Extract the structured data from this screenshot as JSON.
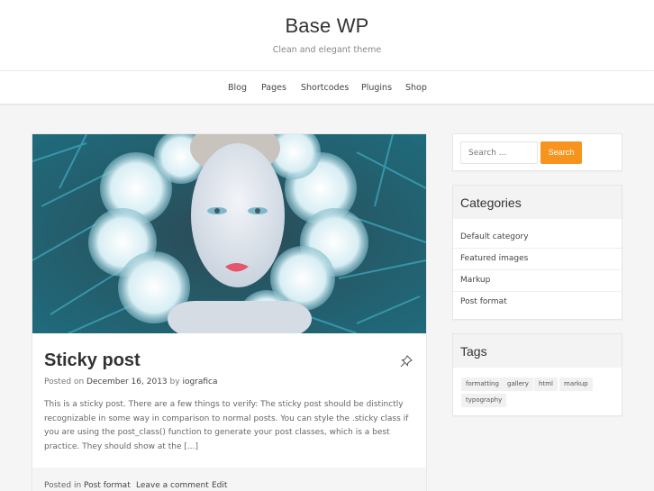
{
  "header": {
    "site_title": "Base WP",
    "site_description": "Clean and elegant theme"
  },
  "nav": {
    "items": [
      {
        "label": "Blog"
      },
      {
        "label": "Pages"
      },
      {
        "label": "Shortcodes"
      },
      {
        "label": "Plugins"
      },
      {
        "label": "Shop"
      }
    ]
  },
  "post": {
    "featured_image_alt": "Woman lying among white flowers and teal grass",
    "title": "Sticky post",
    "sticky_icon": "pushpin-icon",
    "meta": {
      "posted_on_label": "Posted on",
      "date": "December 16, 2013",
      "by_label": "by",
      "author": "iografica"
    },
    "excerpt": "This is a sticky post. There are a few things to verify: The sticky post should be distinctly recognizable in some way in comparison to normal posts. You can style the .sticky class if you are using the post_class() function to generate your post classes, which is a best practice. They should show at the [...]",
    "footer": {
      "posted_in_label": "Posted in",
      "category": "Post format",
      "comment_link": "Leave a comment",
      "edit_link": "Edit"
    }
  },
  "sidebar": {
    "search": {
      "placeholder": "Search ...",
      "button_label": "Search",
      "accent_color": "#f7941d"
    },
    "categories": {
      "title": "Categories",
      "items": [
        {
          "label": "Default category"
        },
        {
          "label": "Featured images"
        },
        {
          "label": "Markup"
        },
        {
          "label": "Post format"
        }
      ]
    },
    "tags": {
      "title": "Tags",
      "items": [
        {
          "label": "formatting"
        },
        {
          "label": "gallery"
        },
        {
          "label": "html"
        },
        {
          "label": "markup"
        },
        {
          "label": "typography"
        }
      ]
    }
  }
}
